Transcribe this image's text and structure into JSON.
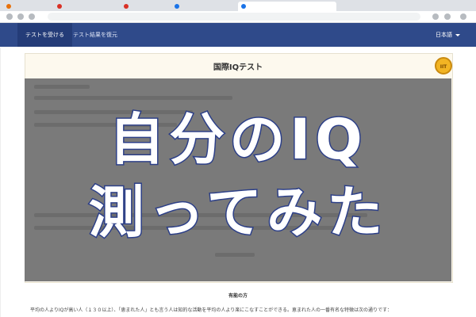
{
  "browser": {
    "tabs": [
      {
        "label": "",
        "color": "#e8710a",
        "active": false
      },
      {
        "label": "",
        "color": "#d93025",
        "active": false
      },
      {
        "label": "",
        "color": "#d93025",
        "active": false
      },
      {
        "label": "",
        "color": "#1a73e8",
        "active": false
      },
      {
        "label": "",
        "color": "#1a73e8",
        "active": true
      }
    ]
  },
  "nav": {
    "take_test": "テストを受ける",
    "search_results": "テスト結果を復元",
    "language": "日本語"
  },
  "page": {
    "title": "国際IQテスト",
    "badge": "IIT"
  },
  "overlay": {
    "line1": "自分のIQ",
    "line2": "測ってみた"
  },
  "section": {
    "title": "有能の方",
    "body": "平均の人よりIQが高い人（１３０以上）、「恵まれた人」とも言う人は知的な活動を平均の人より楽にこなすことができる。恵まれた人の一番有名な特徴は次の通りです："
  },
  "colors": {
    "navbar": "#2f4a8a",
    "accent": "#2c3f88",
    "badge": "#f2b423"
  }
}
